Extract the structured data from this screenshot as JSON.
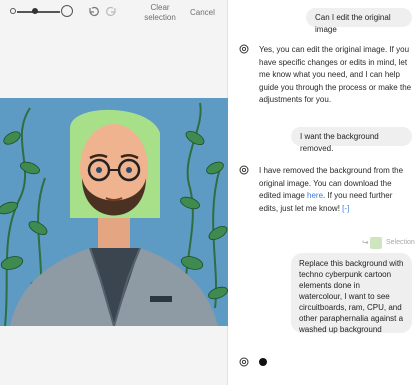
{
  "toolbar": {
    "brush_size_fraction": 0.42,
    "clear_selection_label": "Clear selection",
    "cancel_label": "Cancel",
    "icons": [
      "brush-size-small-icon",
      "brush-size-large-icon",
      "undo-icon",
      "redo-icon"
    ]
  },
  "editor": {
    "image_alt": "Portrait illustration of a bald bearded man with glasses in a grey suit jacket against a blue background with green vines"
  },
  "chat": {
    "messages": [
      {
        "role": "user",
        "text": "Can I edit the original image"
      },
      {
        "role": "assistant",
        "text": "Yes, you can edit the original image. If you have specific changes or edits in mind, let me know what you need, and I can help guide you through the process or make the adjustments for you."
      },
      {
        "role": "user",
        "text": "I want the background removed."
      },
      {
        "role": "assistant",
        "text_before": "I have removed the background from the original image. You can download the edited image ",
        "link": "here",
        "text_after": ". If you need further edits, just let me know!",
        "link_icon": "[-]"
      },
      {
        "role": "user",
        "text": "Replace this background with techno cyberpunk cartoon elements done in watercolour, I want to see circuitboards, ram, CPU, and other paraphernalia against a washed up background"
      }
    ],
    "selection_label": "Selection"
  },
  "colors": {
    "link": "#3a7bd5",
    "bubble": "#efefef",
    "bg_blue": "#5d9bc4",
    "vine_green": "#3e8a4f"
  }
}
